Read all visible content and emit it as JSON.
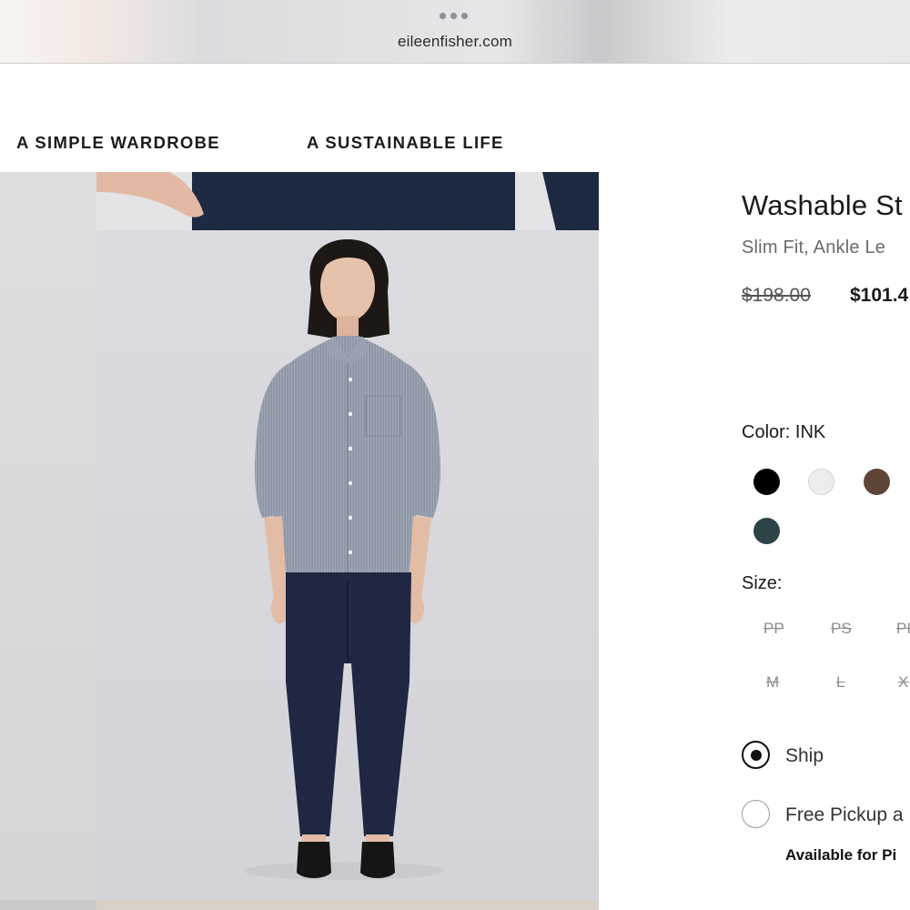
{
  "browser": {
    "url": "eileenfisher.com"
  },
  "nav": {
    "items": [
      {
        "label": "A SIMPLE WARDROBE"
      },
      {
        "label": "A SUSTAINABLE LIFE"
      }
    ]
  },
  "product": {
    "title": "Washable St",
    "subtitle": "Slim Fit, Ankle Le",
    "original_price": "$198.00",
    "sale_price": "$101.4",
    "color_label": "Color: INK",
    "colors": [
      {
        "name": "black",
        "hex": "#000000"
      },
      {
        "name": "white",
        "hex": "#ededf0"
      },
      {
        "name": "brown",
        "hex": "#5e4538"
      },
      {
        "name": "ink",
        "hex": "#2c4348"
      }
    ],
    "size_label": "Size:",
    "sizes": [
      "PP",
      "PS",
      "PI",
      "M",
      "L",
      "X"
    ],
    "fulfillment": {
      "ship_label": "Ship",
      "pickup_label": "Free Pickup a",
      "selected": "ship",
      "availability": "Available for Pi"
    }
  },
  "colors": {
    "text": "#1a1a1a",
    "muted": "#6b6b6b",
    "unavailable": "#8c8c8c"
  }
}
